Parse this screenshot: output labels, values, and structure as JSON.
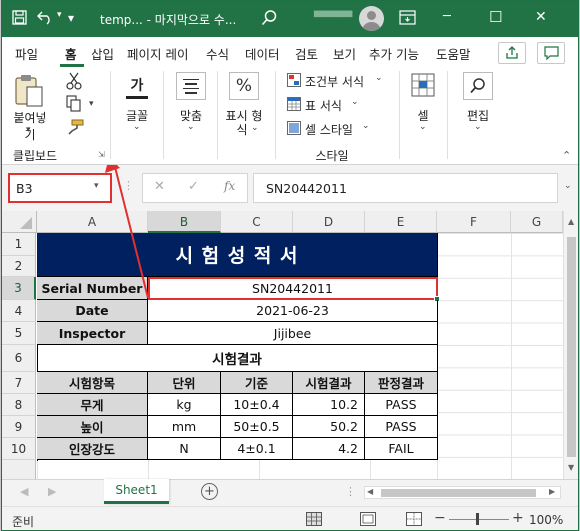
{
  "titlebar": {
    "save_icon": "save-icon",
    "undo_icon": "undo-icon",
    "redo_icon": "redo-icon",
    "title": "temp... - 마지막으로 수...",
    "search_icon": "search-icon",
    "user_name": "▀▀▀▀▀",
    "minimize": "─",
    "maximize": "☐",
    "close": "✕"
  },
  "tabs": {
    "file": "파일",
    "home": "홈",
    "insert": "삽입",
    "page_layout": "페이지 레이",
    "formulas": "수식",
    "data": "데이터",
    "review": "검토",
    "view": "보기",
    "addins": "추가 기능",
    "help": "도움말"
  },
  "ribbon": {
    "paste": "붙여넣기",
    "clipboard": "클립보드",
    "font": "글꼴",
    "font_glyph": "가",
    "alignment": "맞춤",
    "number_line1": "표시 형",
    "number_line2": "식",
    "percent": "%",
    "cond_format": "조건부 서식",
    "format_table": "표 서식",
    "cell_styles": "셀 스타일",
    "styles_group": "스타일",
    "cells": "셀",
    "editing": "편집"
  },
  "formula_bar": {
    "name_box": "B3",
    "fx": "fx",
    "formula": "SN20442011"
  },
  "columns": [
    "A",
    "B",
    "C",
    "D",
    "E",
    "F",
    "G"
  ],
  "rows": [
    "1",
    "2",
    "3",
    "4",
    "5",
    "6",
    "7",
    "8",
    "9",
    "10"
  ],
  "sheet": {
    "title": "시 험 성 적 서",
    "serial_label": "Serial Number",
    "serial_value": "SN20442011",
    "date_label": "Date",
    "date_value": "2021-06-23",
    "inspector_label": "Inspector",
    "inspector_value": "Jijibee",
    "results_header": "시험결과",
    "headers": [
      "시험항목",
      "단위",
      "기준",
      "시험결과",
      "판정결과"
    ],
    "data": [
      [
        "무게",
        "kg",
        "10±0.4",
        "10.2",
        "PASS"
      ],
      [
        "높이",
        "mm",
        "50±0.5",
        "50.2",
        "PASS"
      ],
      [
        "인장강도",
        "N",
        "4±0.1",
        "4.2",
        "FAIL"
      ]
    ]
  },
  "sheet_tab": "Sheet1",
  "status": {
    "ready": "준비",
    "zoom": "100%",
    "zoom_minus": "−",
    "zoom_plus": "+"
  },
  "colors": {
    "accent": "#217346",
    "title_fill": "#002060",
    "highlight": "#e03030"
  }
}
